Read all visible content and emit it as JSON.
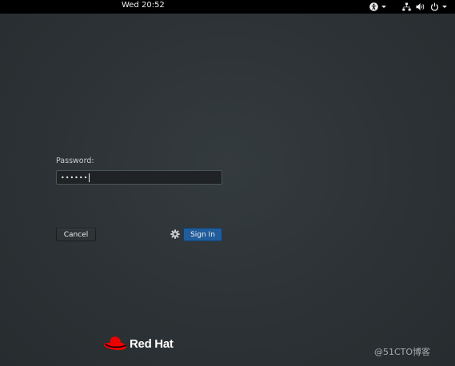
{
  "topbar": {
    "clock": "Wed 20:52",
    "icons": [
      "accessibility-icon",
      "network-icon",
      "volume-icon",
      "power-icon"
    ]
  },
  "login": {
    "password_label": "Password:",
    "password_value": "••••••",
    "cancel_label": "Cancel",
    "signin_label": "Sign In",
    "settings_icon": "gear-icon"
  },
  "branding": {
    "logo_text": "Red Hat",
    "logo_color": "#ee0000"
  },
  "watermark": {
    "text": "@51CTO博客"
  },
  "colors": {
    "accent": "#215d9c",
    "background": "#2c3235",
    "topbar": "#000000"
  }
}
